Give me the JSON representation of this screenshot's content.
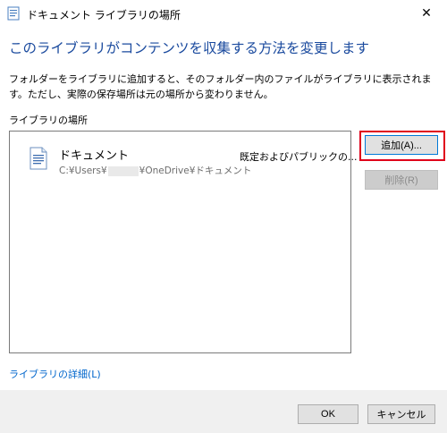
{
  "window": {
    "title": "ドキュメント ライブラリの場所",
    "close_symbol": "✕"
  },
  "heading": "このライブラリがコンテンツを収集する方法を変更します",
  "description": "フォルダーをライブラリに追加すると、そのフォルダー内のファイルがライブラリに表示されます。ただし、実際の保存場所は元の場所から変わりません。",
  "section_label": "ライブラリの場所",
  "locations": [
    {
      "name": "ドキュメント",
      "path_prefix": "C:¥Users¥",
      "path_suffix": "¥OneDrive¥ドキュメント",
      "status": "既定およびパブリックの..."
    }
  ],
  "buttons": {
    "add": "追加(A)...",
    "remove": "削除(R)",
    "ok": "OK",
    "cancel": "キャンセル"
  },
  "details_link": "ライブラリの詳細(L)",
  "colors": {
    "heading": "#1a4a9e",
    "link": "#0066cc",
    "highlight": "#e0001b"
  }
}
